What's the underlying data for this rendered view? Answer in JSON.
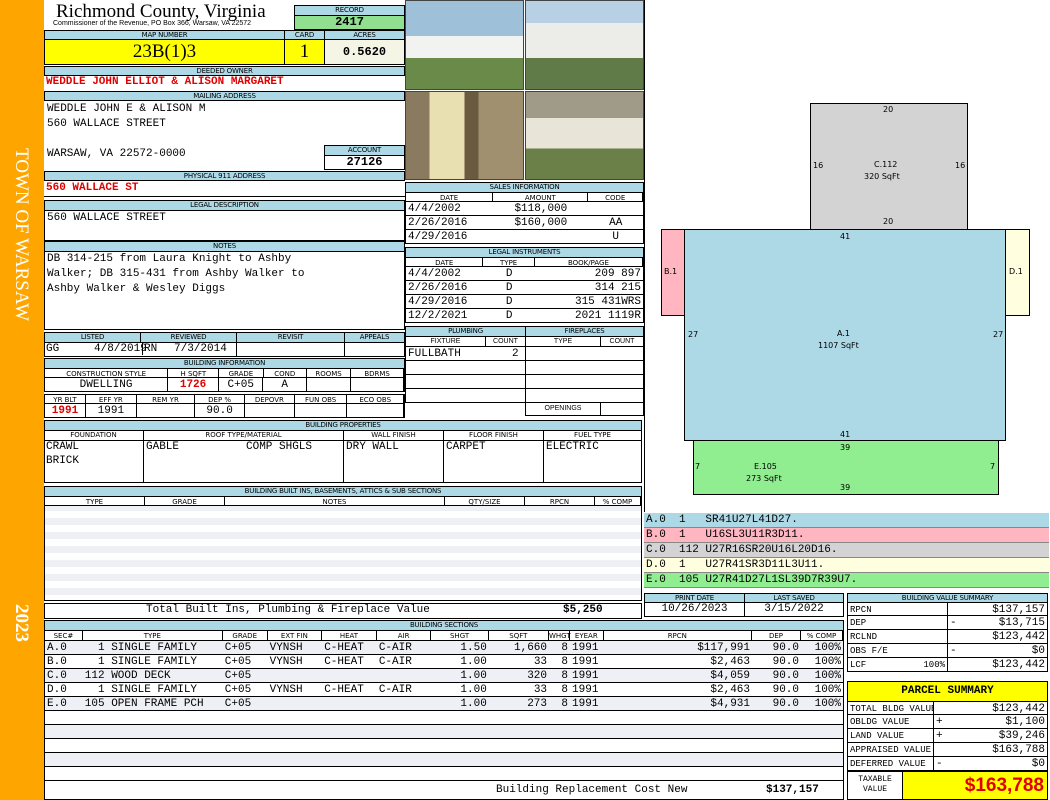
{
  "side": {
    "town": "TOWN OF WARSAW",
    "year": "2023"
  },
  "header": {
    "county": "Richmond County, Virginia",
    "subtitle": "Commissioner of the Revenue, PO Box 366, Warsaw, VA 22572",
    "record_label": "RECORD",
    "record": "2417"
  },
  "parcel": {
    "map_label": "MAP NUMBER",
    "map": "23B(1)3",
    "card_label": "CARD",
    "card": "1",
    "acres_label": "ACRES",
    "acres": "0.5620"
  },
  "owner": {
    "label": "DEEDED OWNER",
    "value": "WEDDLE JOHN ELLIOT & ALISON MARGARET"
  },
  "mailing": {
    "label": "MAILING ADDRESS",
    "line1": "WEDDLE JOHN E & ALISON M",
    "line2": "560 WALLACE STREET",
    "line3": "WARSAW, VA 22572-0000",
    "account_label": "ACCOUNT",
    "account": "27126"
  },
  "physical": {
    "label": "PHYSICAL 911 ADDRESS",
    "value": "560 WALLACE ST"
  },
  "legal": {
    "label": "LEGAL DESCRIPTION",
    "value": "560 WALLACE STREET"
  },
  "notes": {
    "label": "NOTES",
    "lines": [
      "DB 314-215 from Laura Knight to Ashby",
      "Walker; DB 315-431 from Ashby Walker to",
      "Ashby Walker & Wesley Diggs"
    ]
  },
  "listing": {
    "headers": [
      "LISTED",
      "REVIEWED",
      "REVISIT",
      "APPEALS"
    ],
    "listed_by": "GG",
    "listed": "4/8/2019",
    "reviewed_by": "RN",
    "reviewed": "7/3/2014"
  },
  "building_info": {
    "label": "BUILDING INFORMATION",
    "h1": [
      "CONSTRUCTION STYLE",
      "H SQFT",
      "GRADE",
      "COND",
      "ROOMS",
      "BDRMS"
    ],
    "v1": [
      "DWELLING",
      "1726",
      "C+05",
      "A",
      "",
      ""
    ],
    "h2": [
      "YR BLT",
      "EFF YR",
      "REM YR",
      "DEP %",
      "DEPOVR",
      "FUN OBS",
      "ECO OBS"
    ],
    "v2": [
      "1991",
      "1991",
      "",
      "90.0",
      "",
      "",
      ""
    ]
  },
  "properties": {
    "label": "BUILDING PROPERTIES",
    "headers": [
      "FOUNDATION",
      "ROOF TYPE/MATERIAL",
      "WALL FINISH",
      "FLOOR FINISH",
      "FUEL TYPE"
    ],
    "foundation": [
      "CRAWL",
      "BRICK"
    ],
    "roof_type": "GABLE",
    "roof_material": "COMP SHGLS",
    "wall": "DRY WALL",
    "floor": "CARPET",
    "fuel": "ELECTRIC"
  },
  "builtins": {
    "label": "BUILDING BUILT INS, BASEMENTS, ATTICS & SUB SECTIONS",
    "headers": [
      "TYPE",
      "GRADE",
      "NOTES",
      "QTY/SIZE",
      "RPCN",
      "% COMP"
    ],
    "total_label": "Total Built Ins, Plumbing & Fireplace Value",
    "total": "$5,250"
  },
  "sections": {
    "label": "BUILDING SECTIONS",
    "headers": [
      "SEC#",
      "TYPE",
      "GRADE",
      "EXT FIN",
      "HEAT",
      "AIR",
      "SHGT",
      "SQFT",
      "WHGT",
      "EYEAR",
      "RPCN",
      "DEP",
      "% COMP"
    ],
    "rows": [
      [
        "A.0",
        "  1 SINGLE FAMILY",
        "C+05",
        "VYNSH",
        "C-HEAT",
        "C-AIR",
        "1.50",
        "1,660",
        "8",
        "1991",
        "$117,991",
        "90.0",
        "100%"
      ],
      [
        "B.0",
        "  1 SINGLE FAMILY",
        "C+05",
        "VYNSH",
        "C-HEAT",
        "C-AIR",
        "1.00",
        "33",
        "8",
        "1991",
        "$2,463",
        "90.0",
        "100%"
      ],
      [
        "C.0",
        "112 WOOD DECK",
        "C+05",
        "",
        "",
        "",
        "1.00",
        "320",
        "8",
        "1991",
        "$4,059",
        "90.0",
        "100%"
      ],
      [
        "D.0",
        "  1 SINGLE FAMILY",
        "C+05",
        "VYNSH",
        "C-HEAT",
        "C-AIR",
        "1.00",
        "33",
        "8",
        "1991",
        "$2,463",
        "90.0",
        "100%"
      ],
      [
        "E.0",
        "105 OPEN FRAME PCH",
        "C+05",
        "",
        "",
        "",
        "1.00",
        "273",
        "8",
        "1991",
        "$4,931",
        "90.0",
        "100%"
      ]
    ],
    "replacement_label": "Building Replacement Cost New",
    "replacement": "$137,157"
  },
  "sales": {
    "label": "SALES INFORMATION",
    "headers": [
      "DATE",
      "AMOUNT",
      "CODE"
    ],
    "rows": [
      [
        "4/4/2002",
        "$118,000",
        ""
      ],
      [
        "2/26/2016",
        "$160,000",
        "AA"
      ],
      [
        "4/29/2016",
        "",
        "U"
      ]
    ]
  },
  "instruments": {
    "label": "LEGAL INSTRUMENTS",
    "headers": [
      "DATE",
      "TYPE",
      "BOOK/PAGE"
    ],
    "rows": [
      [
        "4/4/2002",
        "D",
        "209 897"
      ],
      [
        "2/26/2016",
        "D",
        "314 215"
      ],
      [
        "4/29/2016",
        "D",
        "315 431WRS"
      ],
      [
        "12/2/2021",
        "D",
        "2021 1119R"
      ]
    ]
  },
  "plumbing": {
    "label": "PLUMBING",
    "headers": [
      "FIXTURE",
      "COUNT"
    ],
    "fixture": "FULLBATH",
    "count": "2"
  },
  "fireplaces": {
    "label": "FIREPLACES",
    "headers": [
      "TYPE",
      "COUNT"
    ],
    "openings": "OPENINGS"
  },
  "sketch": {
    "colors": {
      "A": "#add8e6",
      "B": "#ffb6c1",
      "C": "#d3d3d3",
      "D": "#ffffe0",
      "E": "#90ee90"
    },
    "C": {
      "name": "C.112",
      "area": "320 SqFt",
      "top": "20",
      "bottom": "20",
      "left": "16",
      "right": "16"
    },
    "A": {
      "name": "A.1",
      "area": "1107 SqFt",
      "top": "41",
      "bottom": "41",
      "left": "27",
      "right": "27"
    },
    "B": {
      "name": "B.1"
    },
    "D": {
      "name": "D.1"
    },
    "E": {
      "name": "E.105",
      "area": "273 SqFt",
      "top": "39",
      "bottom": "39",
      "left": "7",
      "right": "7"
    },
    "legend": [
      "A.0  1   SR41U27L41D27.",
      "B.0  1   U16SL3U11R3D11.",
      "C.0  112 U27R16SR20U16L20D16.",
      "D.0  1   U27R41SR3D11L3U11.",
      "E.0  105 U27R41D27L1SL39D7R39U7."
    ]
  },
  "dates": {
    "print_label": "PRINT DATE",
    "print": "10/26/2023",
    "saved_label": "LAST SAVED",
    "saved": "3/15/2022"
  },
  "value_summary": {
    "label": "BUILDING VALUE SUMMARY",
    "rows": [
      {
        "k": "RPCN",
        "s": "",
        "v": "$137,157"
      },
      {
        "k": "DEP",
        "s": "-",
        "v": "$13,715"
      },
      {
        "k": "RCLND",
        "s": "",
        "v": "$123,442"
      },
      {
        "k": "OBS F/E",
        "s": "-",
        "v": "$0"
      },
      {
        "k": "LCF",
        "p": "100%",
        "s": "",
        "v": "$123,442"
      }
    ]
  },
  "parcel_summary": {
    "title": "PARCEL SUMMARY",
    "rows": [
      {
        "k": "TOTAL BLDG VALUE",
        "s": "",
        "v": "$123,442"
      },
      {
        "k": "OBLDG VALUE",
        "s": "+",
        "v": "$1,100"
      },
      {
        "k": "LAND VALUE",
        "s": "+",
        "v": "$39,246"
      },
      {
        "k": "APPRAISED VALUE",
        "s": "",
        "v": "$163,788"
      },
      {
        "k": "DEFERRED VALUE",
        "s": "-",
        "v": "$0"
      }
    ],
    "taxable_label": "TAXABLE VALUE",
    "taxable": "$163,788"
  }
}
